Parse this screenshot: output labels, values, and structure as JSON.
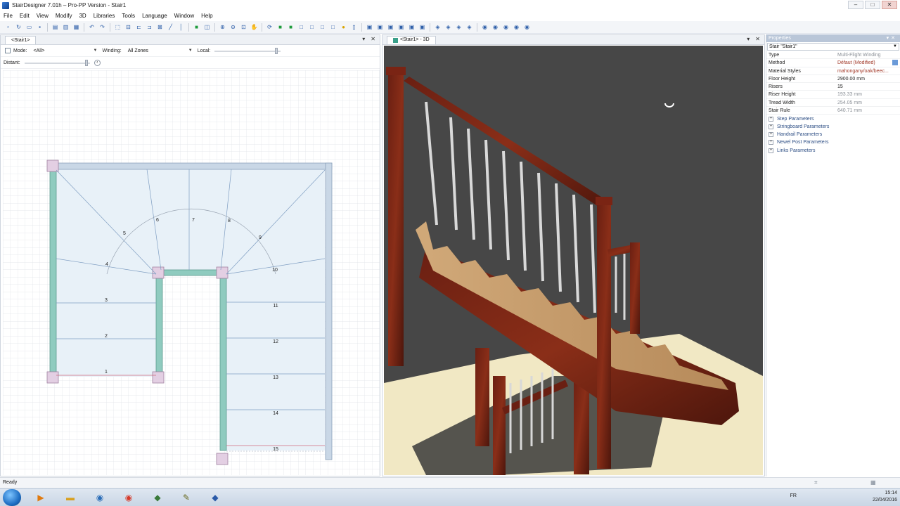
{
  "app": {
    "title": "StairDesigner 7.01h – Pro-PP Version - Stair1",
    "window_buttons": [
      "–",
      "□",
      "✕"
    ]
  },
  "menu": [
    "File",
    "Edit",
    "View",
    "Modify",
    "3D",
    "Libraries",
    "Tools",
    "Language",
    "Window",
    "Help"
  ],
  "plan_panel": {
    "tab_label": "<Stair1>",
    "mode_label": "Mode:",
    "mode_value": "<All>",
    "winding_label": "Winding:",
    "winding_value": "All Zones",
    "local_label": "Local:",
    "distant_label": "Distant:",
    "step_numbers": [
      "1",
      "2",
      "3",
      "4",
      "5",
      "6",
      "7",
      "8",
      "9",
      "10",
      "11",
      "12",
      "13",
      "14",
      "15"
    ]
  },
  "view3d": {
    "tab_label": "<Stair1> - 3D"
  },
  "properties": {
    "header": "Properties",
    "selector": "Stair \"Stair1\"",
    "rows": [
      {
        "key": "Type",
        "value": "Multi-Flight Winding",
        "style": "grey"
      },
      {
        "key": "Method",
        "value": "Défaut (Modified)",
        "style": "red"
      },
      {
        "key": "Material Styles",
        "value": "mahongany/oak/beec...",
        "style": "red"
      },
      {
        "key": "Floor Height",
        "value": "2900.00 mm",
        "style": "dark"
      },
      {
        "key": "Risers",
        "value": "15",
        "style": "dark"
      },
      {
        "key": "Riser Height",
        "value": "193.33 mm",
        "style": "grey"
      },
      {
        "key": "Tread Width",
        "value": "254.05 mm",
        "style": "grey"
      },
      {
        "key": "Stair Rule",
        "value": "640.71 mm",
        "style": "grey"
      }
    ],
    "groups": [
      "Step Parameters",
      "Stringboard Parameters",
      "Handrail Parameters",
      "Newel Post Parameters",
      "Links Parameters"
    ]
  },
  "status": {
    "text": "Ready"
  },
  "taskbar": {
    "lang": "FR",
    "time": "15:14",
    "date": "22/04/2016"
  }
}
